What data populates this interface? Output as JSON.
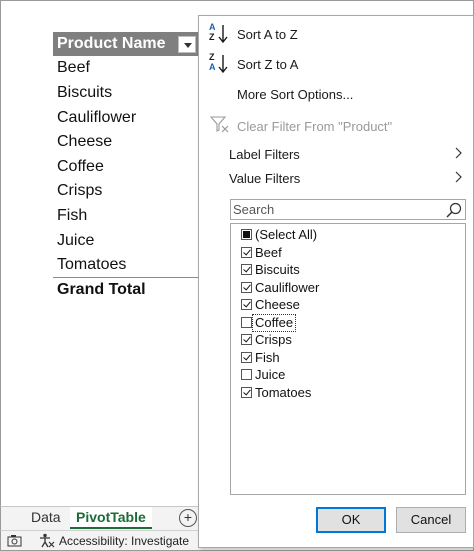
{
  "pivot": {
    "header": "Product Name",
    "rows": [
      "Beef",
      "Biscuits",
      "Cauliflower",
      "Cheese",
      "Coffee",
      "Crisps",
      "Fish",
      "Juice",
      "Tomatoes"
    ],
    "grand_total": "Grand Total"
  },
  "tabs": {
    "data": "Data",
    "pivot": "PivotTable",
    "add": "+"
  },
  "status": {
    "accessibility": "Accessibility: Investigate"
  },
  "filter": {
    "sort_az": "Sort A to Z",
    "sort_za": "Sort Z to A",
    "more_sort": "More Sort Options...",
    "clear_filter": "Clear Filter From \"Product\"",
    "label_filters": "Label Filters",
    "value_filters": "Value Filters",
    "search_placeholder": "Search",
    "items": [
      {
        "label": "(Select All)",
        "state": "mixed"
      },
      {
        "label": "Beef",
        "state": "checked"
      },
      {
        "label": "Biscuits",
        "state": "checked"
      },
      {
        "label": "Cauliflower",
        "state": "checked"
      },
      {
        "label": "Cheese",
        "state": "checked"
      },
      {
        "label": "Coffee",
        "state": "unchecked"
      },
      {
        "label": "Crisps",
        "state": "checked"
      },
      {
        "label": "Fish",
        "state": "checked"
      },
      {
        "label": "Juice",
        "state": "unchecked"
      },
      {
        "label": "Tomatoes",
        "state": "checked"
      }
    ],
    "ok": "OK",
    "cancel": "Cancel"
  },
  "colors": {
    "accent_green": "#1d6b37",
    "header_gray": "#7f7f7f",
    "focus_blue": "#0078d7"
  }
}
